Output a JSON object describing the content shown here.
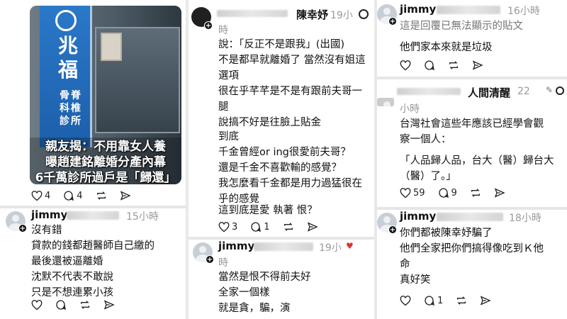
{
  "col1": {
    "media": {
      "sign_big": "兆福",
      "sign_small": "骨脊科椎診所",
      "caption": [
        "親友揭：不用靠女人養",
        "曝趙建銘離婚分產內幕",
        "6千萬診所過戶是「歸還」"
      ]
    },
    "post1_actions": {
      "likes": "4",
      "comments": "4"
    },
    "reply": {
      "user": "jimmy",
      "time": "15小時",
      "lines": [
        "沒有錯",
        "貸款的錢都趙醫師自己繳的",
        "最後還被逼離婚",
        "沈默不代表不敢說",
        "只是不想連累小孩"
      ]
    }
  },
  "col2": {
    "post1": {
      "user": "陳幸妤",
      "time": "19小",
      "time_wrap": "時",
      "lines": [
        "說：「反正不是跟我」(出國)",
        "不是都早就離婚了 當然沒有姐這",
        "選項",
        "很在乎芊芊是不是有跟前夫哥一",
        "腿",
        "說搞不好是往臉上貼金"
      ],
      "lines2": [
        "到底",
        "千金曾經or ing很愛前夫哥？",
        "還是千金不喜歡輸的感覺？",
        "我怎麼看千金都是用力過猛很在",
        "乎的感覺"
      ],
      "lines3": [
        "這到底是愛 執著 恨？"
      ],
      "likes": "3",
      "comments": "1"
    },
    "post2": {
      "user": "jimmy",
      "time": "19小",
      "time_wrap": "時",
      "lines": [
        "當然是恨不得前夫好",
        "全家一個樣",
        "就是貪，騙，演"
      ]
    }
  },
  "col3": {
    "post1": {
      "user": "jimmy",
      "time": "16小時",
      "quote": "這是回覆已無法顯示的貼文",
      "lines": [
        "他們家本來就是垃圾"
      ]
    },
    "post2": {
      "user": "人間清醒",
      "time": "22",
      "time_wrap": "小時",
      "lines": [
        "台灣社會這些年應該已經學會觀",
        "察一個人："
      ],
      "lines2": [
        "「人品歸人品，台大（醫）歸台大",
        "（醫）了。」"
      ],
      "likes": "59",
      "comments": "9"
    },
    "post3": {
      "user": "jimmy",
      "time": "18小時",
      "lines": [
        "你們都被陳幸妤騙了",
        "他們全家把你們搞得像吃到Ｋ他",
        "命",
        "真好笑"
      ],
      "comments": "1"
    }
  }
}
